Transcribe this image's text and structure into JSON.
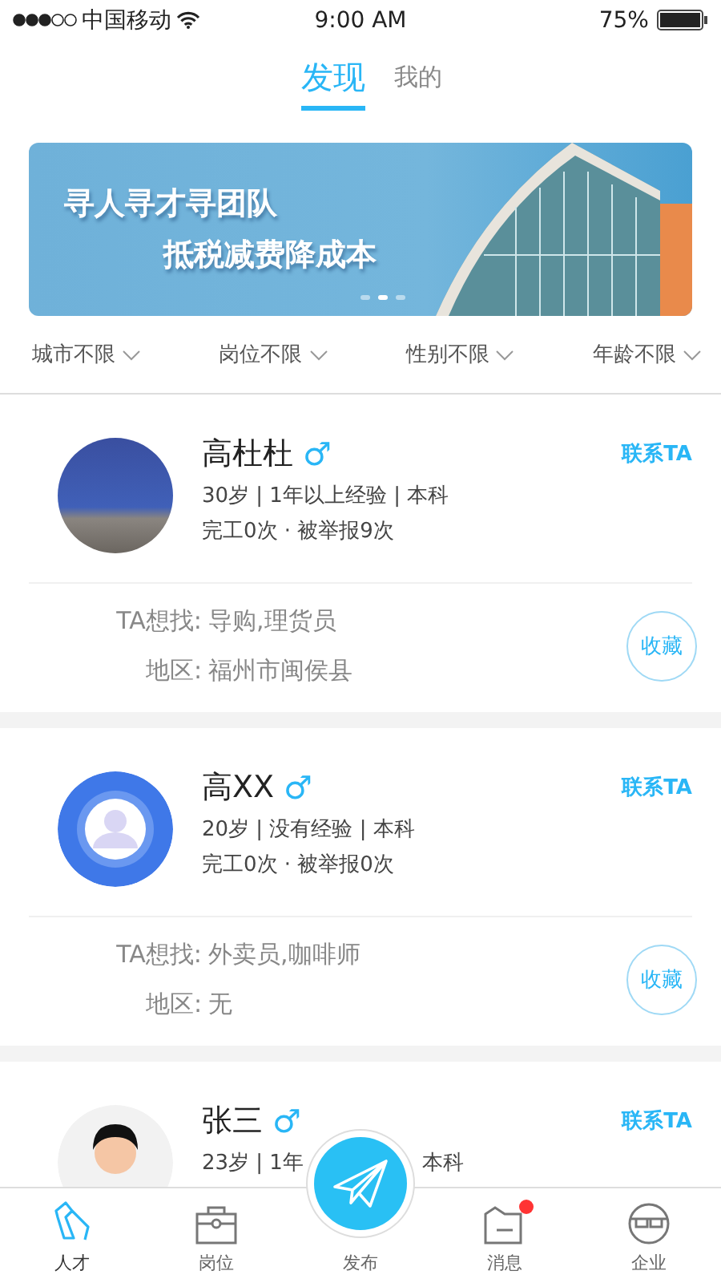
{
  "status_bar": {
    "carrier": "中国移动",
    "time": "9:00 AM",
    "battery": "75%"
  },
  "tabs": [
    {
      "label": "发现",
      "selected": true
    },
    {
      "label": "我的",
      "selected": false
    }
  ],
  "banner": {
    "line_1": "寻人寻才寻团队",
    "line_2": "抵税减费降成本",
    "slides": [
      {
        "selected": false
      },
      {
        "selected": true
      },
      {
        "selected": false
      }
    ]
  },
  "filters": [
    "城市不限",
    "岗位不限",
    "性别不限",
    "年龄不限"
  ],
  "cards": [
    {
      "kind": "photo",
      "name": "高杜杜",
      "gender": "♂",
      "contact": "联系TA",
      "meta": "30岁 | 1年以上经验 | 本科",
      "stats": "完工0次 · 被举报9次",
      "want_label": "TA想找:",
      "want": "导购,理货员",
      "area_label": "地区:",
      "area": "福州市闽侯县",
      "save": "收藏"
    },
    {
      "kind": "default",
      "name": "高XX",
      "gender": "♂",
      "contact": "联系TA",
      "meta": "20岁 | 没有经验 | 本科",
      "stats": "完工0次 · 被举报0次",
      "want_label": "TA想找:",
      "want": "外卖员,咖啡师",
      "area_label": "地区:",
      "area": "无",
      "save": "收藏"
    },
    {
      "kind": "cartoon",
      "name": "张三",
      "gender": "♂",
      "contact": "联系TA",
      "meta_parts": [
        "23岁 | 1年",
        "本科"
      ]
    }
  ],
  "nav": [
    {
      "kind": "tie",
      "label": "人才",
      "selected": true,
      "badge": false
    },
    {
      "kind": "bag",
      "label": "岗位",
      "selected": false,
      "badge": false
    },
    {
      "kind": "publish",
      "label": "发布",
      "selected": false,
      "badge": false
    },
    {
      "kind": "folder",
      "label": "消息",
      "selected": false,
      "badge": true
    },
    {
      "kind": "glasses",
      "label": "企业",
      "selected": false,
      "badge": false
    }
  ]
}
